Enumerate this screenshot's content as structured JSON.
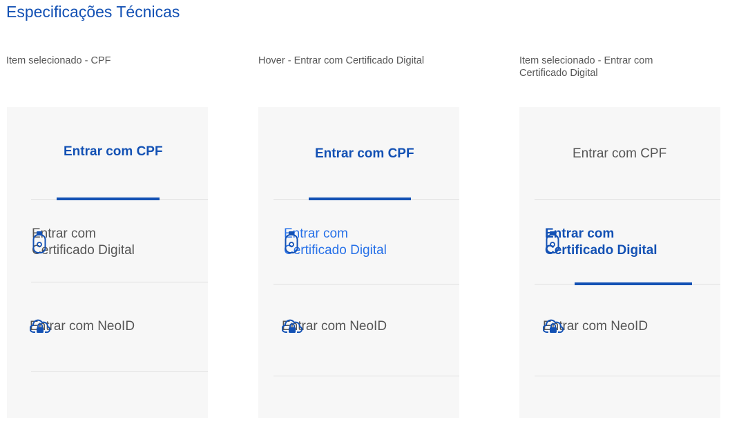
{
  "page_title": "Especificações Técnicas",
  "colors": {
    "primary": "#1351b4",
    "hover": "#2670e8",
    "text": "#555555",
    "panel_bg": "#f7f7f7",
    "divider": "#e0e0e0"
  },
  "states": [
    {
      "caption": "Item selecionado - CPF",
      "options": {
        "cpf": "Entrar com CPF",
        "cert": "Entrar com Certificado Digital",
        "cert_line1": "Entrar com",
        "cert_line2": "Certificado Digital",
        "neoid": "Entrar com NeoID"
      },
      "selected": "cpf"
    },
    {
      "caption": "Hover - Entrar com Certificado Digital",
      "options": {
        "cpf": "Entrar com CPF",
        "cert_line1": "Entrar com",
        "cert_line2": "Certificado Digital",
        "neoid": "Entrar com NeoID"
      },
      "selected": "cpf",
      "hover": "cert"
    },
    {
      "caption_line1": "Item selecionado - Entrar com",
      "caption_line2": "Certificado Digital",
      "options": {
        "cpf": "Entrar com CPF",
        "cert_line1": "Entrar com",
        "cert_line2": "Certificado Digital",
        "neoid": "Entrar com NeoID"
      },
      "selected": "cert"
    }
  ],
  "icons": {
    "cert": "usb-token-icon",
    "neoid": "cloud-lock-icon"
  }
}
